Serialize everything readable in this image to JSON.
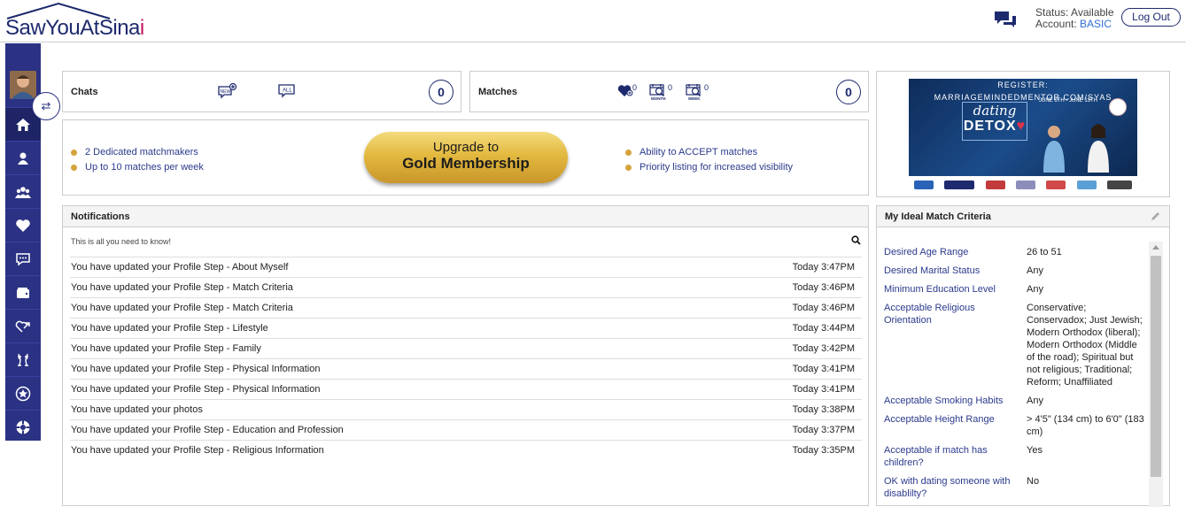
{
  "brand": {
    "name_main": "SawYouAtSina",
    "name_accent": "i"
  },
  "header": {
    "status_label": "Status: Available",
    "account_prefix": "Account: ",
    "account_value": "BASIC",
    "logout_label": "Log Out"
  },
  "sidebar": {
    "items": [
      {
        "name": "home",
        "icon": "home-icon"
      },
      {
        "name": "profile",
        "icon": "person-icon"
      },
      {
        "name": "members",
        "icon": "group-icon"
      },
      {
        "name": "matches",
        "icon": "heart-icon"
      },
      {
        "name": "chats",
        "icon": "chat-bubble-icon"
      },
      {
        "name": "wallet",
        "icon": "wallet-icon"
      },
      {
        "name": "referrals",
        "icon": "heart-arrow-icon"
      },
      {
        "name": "success-stories",
        "icon": "champagne-icon"
      },
      {
        "name": "premium",
        "icon": "star-circle-icon"
      },
      {
        "name": "help",
        "icon": "lifebuoy-icon"
      }
    ]
  },
  "chats": {
    "title": "Chats",
    "new_label": "NEW",
    "all_label": "ALL",
    "count": "0"
  },
  "matches": {
    "title": "Matches",
    "heart_count": "0",
    "month_label": "MONTH",
    "month_count": "0",
    "week_label": "WEEK",
    "week_count": "0",
    "count": "0"
  },
  "upgrade": {
    "left_bullets": [
      "2 Dedicated matchmakers",
      "Up to 10 matches per week"
    ],
    "button_line1": "Upgrade to",
    "button_line2": "Gold Membership",
    "right_bullets": [
      "Ability to ACCEPT matches",
      "Priority listing for increased visibility"
    ]
  },
  "ad": {
    "headline": "REGISTER: MARRIAGEMINDEDMENTOR.COM/SYAS",
    "title_line1": "dating",
    "title_line2": "DETOX",
    "dates": "JUNE 6TH - JUNE 13TH"
  },
  "notifications": {
    "title": "Notifications",
    "subtitle": "This is all you need to know!",
    "items": [
      {
        "text": "You have updated your Profile Step - About Myself",
        "time": "Today 3:47PM"
      },
      {
        "text": "You have updated your Profile Step - Match Criteria",
        "time": "Today 3:46PM"
      },
      {
        "text": "You have updated your Profile Step - Match Criteria",
        "time": "Today 3:46PM"
      },
      {
        "text": "You have updated your Profile Step - Lifestyle",
        "time": "Today 3:44PM"
      },
      {
        "text": "You have updated your Profile Step - Family",
        "time": "Today 3:42PM"
      },
      {
        "text": "You have updated your Profile Step - Physical Information",
        "time": "Today 3:41PM"
      },
      {
        "text": "You have updated your Profile Step - Physical Information",
        "time": "Today 3:41PM"
      },
      {
        "text": "You have updated your photos",
        "time": "Today 3:38PM"
      },
      {
        "text": "You have updated your Profile Step - Education and Profession",
        "time": "Today 3:37PM"
      },
      {
        "text": "You have updated your Profile Step - Religious Information",
        "time": "Today 3:35PM"
      }
    ]
  },
  "criteria": {
    "title": "My Ideal Match Criteria",
    "rows": [
      {
        "label": "Desired Age Range",
        "value": "26 to 51"
      },
      {
        "label": "Desired Marital Status",
        "value": "Any"
      },
      {
        "label": "Minimum Education Level",
        "value": "Any"
      },
      {
        "label": "Acceptable Religious Orientation",
        "value": "Conservative; Conservadox; Just Jewish; Modern Orthodox (liberal); Modern Orthodox (Middle of the road); Spiritual but not religious; Traditional; Reform; Unaffiliated"
      },
      {
        "label": "Acceptable Smoking Habits",
        "value": "Any"
      },
      {
        "label": "Acceptable Height Range",
        "value": "> 4'5\" (134 cm) to 6'0\" (183 cm)"
      },
      {
        "label": "Acceptable if match has children?",
        "value": "Yes"
      },
      {
        "label": "OK with dating someone with disablilty?",
        "value": "No"
      }
    ]
  },
  "colors": {
    "brand_navy": "#2b3283",
    "accent_pink": "#c2185b",
    "gold": "#e3b93f",
    "link_blue": "#2b3a8c"
  }
}
